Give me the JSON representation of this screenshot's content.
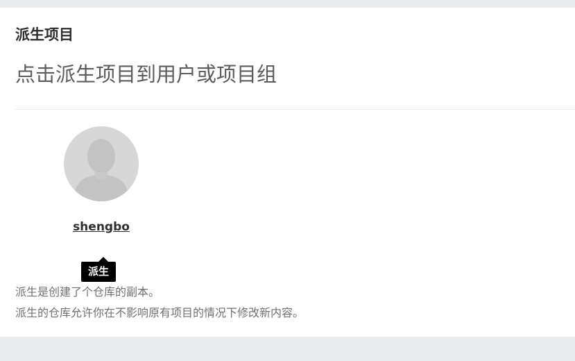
{
  "fork": {
    "title": "派生项目",
    "subtitle": "点击派生项目到用户或项目组",
    "namespace": {
      "name": "shengbo",
      "avatar_icon": "user-avatar-placeholder-icon"
    },
    "tooltip": "派生",
    "help_line_1": "派生是创建了个仓库的副本。",
    "help_line_2": "派生的仓库允许你在不影响原有项目的情况下修改新内容。"
  }
}
